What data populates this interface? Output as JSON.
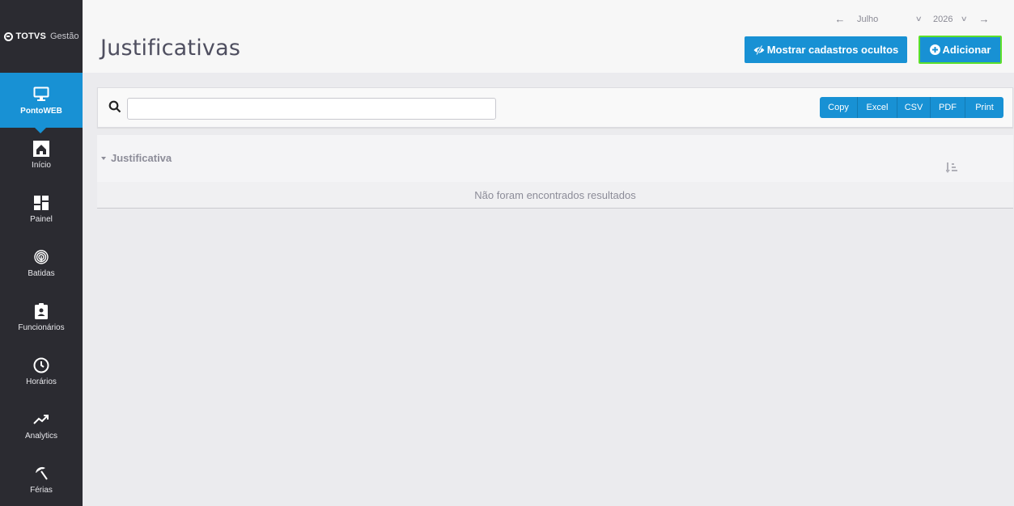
{
  "brand": {
    "name": "TOTVS",
    "product": "Gestão"
  },
  "sidebar": {
    "items": [
      {
        "label": "PontoWEB",
        "icon": "monitor-icon",
        "active": true
      },
      {
        "label": "Início",
        "icon": "home-icon"
      },
      {
        "label": "Painel",
        "icon": "dashboard-icon"
      },
      {
        "label": "Batidas",
        "icon": "fingerprint-icon"
      },
      {
        "label": "Funcionários",
        "icon": "badge-icon"
      },
      {
        "label": "Horários",
        "icon": "clock-icon"
      },
      {
        "label": "Analytics",
        "icon": "trending-up-icon"
      },
      {
        "label": "Férias",
        "icon": "beach-umbrella-icon"
      }
    ]
  },
  "header": {
    "title": "Justificativas",
    "period": {
      "month": "Julho",
      "year": "2026"
    },
    "buttons": {
      "show_hidden": "Mostrar cadastros ocultos",
      "add": "Adicionar"
    }
  },
  "toolbar": {
    "search": {
      "value": "",
      "placeholder": ""
    },
    "export_buttons": [
      "Copy",
      "Excel",
      "CSV",
      "PDF",
      "Print"
    ]
  },
  "table": {
    "columns": [
      "Justificativa"
    ],
    "empty_message": "Não foram encontrados resultados"
  },
  "colors": {
    "accent": "#1891d4",
    "sidebar_bg": "#2b2b31",
    "add_button_border": "#5ce02a"
  }
}
